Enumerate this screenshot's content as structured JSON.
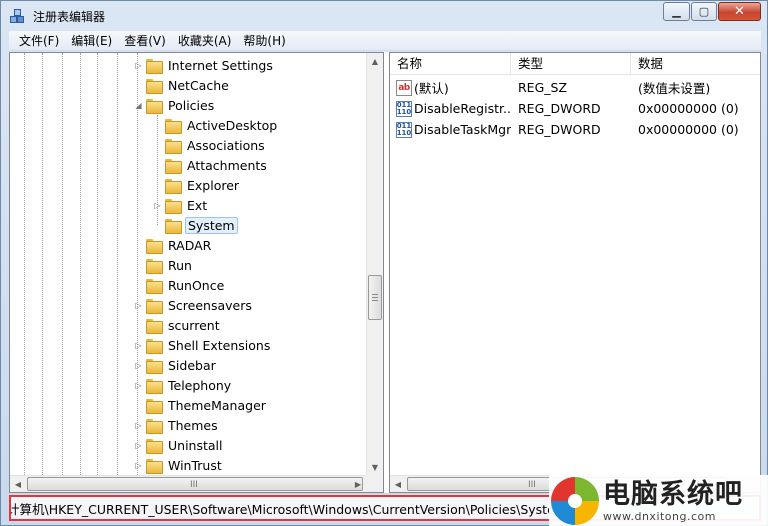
{
  "window": {
    "title": "注册表编辑器",
    "controls": {
      "min": "▁",
      "max": "▢",
      "close": "✕"
    }
  },
  "menu": [
    "文件(F)",
    "编辑(E)",
    "查看(V)",
    "收藏夹(A)",
    "帮助(H)"
  ],
  "tree": {
    "items": [
      {
        "label": "Internet Settings",
        "level": 0,
        "expander": "▷"
      },
      {
        "label": "NetCache",
        "level": 0,
        "expander": ""
      },
      {
        "label": "Policies",
        "level": 0,
        "expander": "◢"
      },
      {
        "label": "ActiveDesktop",
        "level": 1,
        "expander": ""
      },
      {
        "label": "Associations",
        "level": 1,
        "expander": ""
      },
      {
        "label": "Attachments",
        "level": 1,
        "expander": ""
      },
      {
        "label": "Explorer",
        "level": 1,
        "expander": ""
      },
      {
        "label": "Ext",
        "level": 1,
        "expander": "▷"
      },
      {
        "label": "System",
        "level": 1,
        "expander": "",
        "selected": true
      },
      {
        "label": "RADAR",
        "level": 0,
        "expander": ""
      },
      {
        "label": "Run",
        "level": 0,
        "expander": ""
      },
      {
        "label": "RunOnce",
        "level": 0,
        "expander": ""
      },
      {
        "label": "Screensavers",
        "level": 0,
        "expander": "▷"
      },
      {
        "label": "scurrent",
        "level": 0,
        "expander": ""
      },
      {
        "label": "Shell Extensions",
        "level": 0,
        "expander": "▷"
      },
      {
        "label": "Sidebar",
        "level": 0,
        "expander": "▷"
      },
      {
        "label": "Telephony",
        "level": 0,
        "expander": "▷"
      },
      {
        "label": "ThemeManager",
        "level": 0,
        "expander": ""
      },
      {
        "label": "Themes",
        "level": 0,
        "expander": "▷"
      },
      {
        "label": "Uninstall",
        "level": 0,
        "expander": "▷"
      },
      {
        "label": "WinTrust",
        "level": 0,
        "expander": "▷"
      }
    ]
  },
  "values": {
    "columns": [
      "名称",
      "类型",
      "数据"
    ],
    "rows": [
      {
        "name": "(默认)",
        "type": "REG_SZ",
        "data": "(数值未设置)",
        "icon": "string-value-icon"
      },
      {
        "name": "DisableRegistr...",
        "type": "REG_DWORD",
        "data": "0x00000000 (0)",
        "icon": "dword-value-icon"
      },
      {
        "name": "DisableTaskMgr",
        "type": "REG_DWORD",
        "data": "0x00000000 (0)",
        "icon": "dword-value-icon"
      }
    ]
  },
  "scroll_marks": {
    "grip": "III"
  },
  "status": {
    "path": "计算机\\HKEY_CURRENT_USER\\Software\\Microsoft\\Windows\\CurrentVersion\\Policies\\System"
  },
  "watermark": {
    "title": "电脑系统吧",
    "url": "www.dnxitong.com"
  },
  "colors": {
    "status_border": "#e0383a",
    "selection": "#e3effc"
  }
}
